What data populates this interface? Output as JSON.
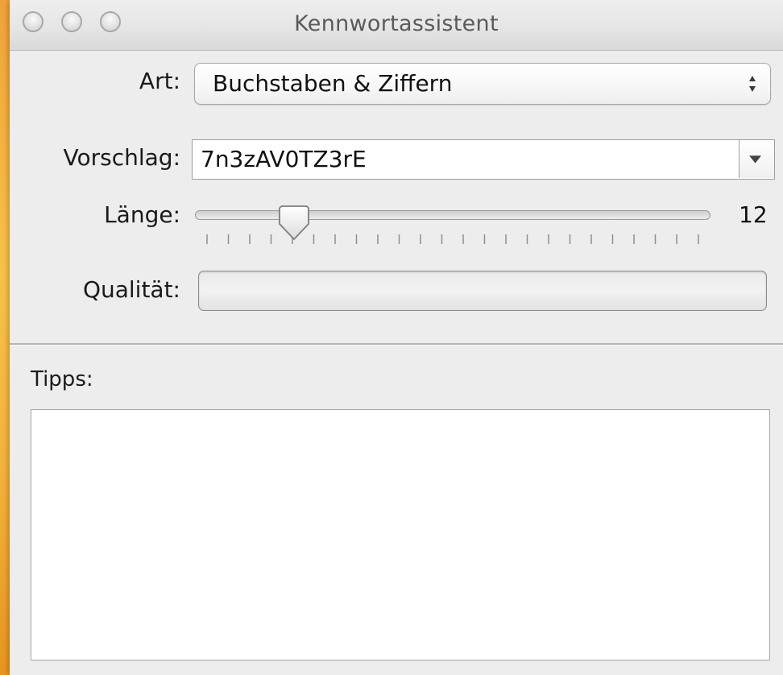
{
  "window": {
    "title": "Kennwortassistent"
  },
  "form": {
    "type_label": "Art:",
    "type_value": "Buchstaben & Ziffern",
    "suggestion_label": "Vorschlag:",
    "suggestion_value": "7n3zAV0TZ3rE",
    "length_label": "Länge:",
    "length_value": "12",
    "length_level": 0.19,
    "quality_label": "Qualität:",
    "quality_level": 0
  },
  "tips": {
    "label": "Tipps:",
    "content": ""
  },
  "icons": {
    "close": "close-icon",
    "minimize": "minimize-icon",
    "zoom": "zoom-icon",
    "popup_arrows": "up-down-arrows-icon",
    "combo_arrow": "triangle-down-icon",
    "slider_thumb": "slider-thumb-icon"
  },
  "colors": {
    "desktop": "#f6c243",
    "window_bg": "#ededed",
    "field_bg": "#ffffff"
  }
}
